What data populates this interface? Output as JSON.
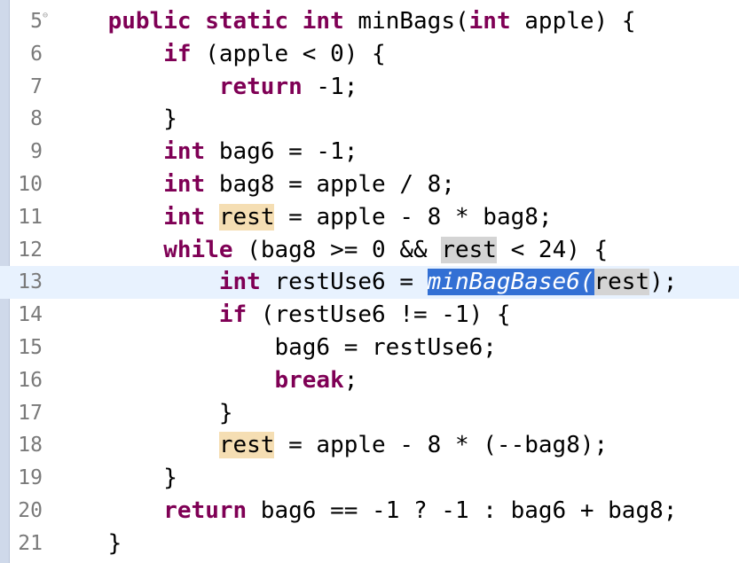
{
  "editor": {
    "lines": [
      {
        "num": "5",
        "tokens": [
          {
            "t": "    "
          },
          {
            "t": "public",
            "c": "kw"
          },
          {
            "t": " "
          },
          {
            "t": "static",
            "c": "kw"
          },
          {
            "t": " "
          },
          {
            "t": "int",
            "c": "kw"
          },
          {
            "t": " minBags("
          },
          {
            "t": "int",
            "c": "kw"
          },
          {
            "t": " apple) {"
          }
        ],
        "fold": true
      },
      {
        "num": "6",
        "tokens": [
          {
            "t": "        "
          },
          {
            "t": "if",
            "c": "kw"
          },
          {
            "t": " (apple < 0) {"
          }
        ]
      },
      {
        "num": "7",
        "tokens": [
          {
            "t": "            "
          },
          {
            "t": "return",
            "c": "kw"
          },
          {
            "t": " -1;"
          }
        ]
      },
      {
        "num": "8",
        "tokens": [
          {
            "t": "        }"
          }
        ]
      },
      {
        "num": "9",
        "tokens": [
          {
            "t": "        "
          },
          {
            "t": "int",
            "c": "kw"
          },
          {
            "t": " bag6 = -1;"
          }
        ]
      },
      {
        "num": "10",
        "tokens": [
          {
            "t": "        "
          },
          {
            "t": "int",
            "c": "kw"
          },
          {
            "t": " bag8 = apple / 8;"
          }
        ]
      },
      {
        "num": "11",
        "tokens": [
          {
            "t": "        "
          },
          {
            "t": "int",
            "c": "kw"
          },
          {
            "t": " "
          },
          {
            "t": "rest",
            "c": "occ"
          },
          {
            "t": " = apple - 8 * bag8;"
          }
        ]
      },
      {
        "num": "12",
        "tokens": [
          {
            "t": "        "
          },
          {
            "t": "while",
            "c": "kw"
          },
          {
            "t": " (bag8 >= 0 && "
          },
          {
            "t": "rest",
            "c": "occ-read"
          },
          {
            "t": " < 24) {"
          }
        ]
      },
      {
        "num": "13",
        "tokens": [
          {
            "t": "            "
          },
          {
            "t": "int",
            "c": "kw"
          },
          {
            "t": " restUse6 = "
          },
          {
            "t": "minBagBase6(",
            "c": "sel"
          },
          {
            "t": "rest",
            "c": "occ-read"
          },
          {
            "t": ");"
          }
        ],
        "current": true
      },
      {
        "num": "14",
        "tokens": [
          {
            "t": "            "
          },
          {
            "t": "if",
            "c": "kw"
          },
          {
            "t": " (restUse6 != -1) {"
          }
        ]
      },
      {
        "num": "15",
        "tokens": [
          {
            "t": "                bag6 = restUse6;"
          }
        ]
      },
      {
        "num": "16",
        "tokens": [
          {
            "t": "                "
          },
          {
            "t": "break",
            "c": "kw"
          },
          {
            "t": ";"
          }
        ]
      },
      {
        "num": "17",
        "tokens": [
          {
            "t": "            }"
          }
        ]
      },
      {
        "num": "18",
        "tokens": [
          {
            "t": "            "
          },
          {
            "t": "rest",
            "c": "occ"
          },
          {
            "t": " = apple - 8 * (--bag8);"
          }
        ]
      },
      {
        "num": "19",
        "tokens": [
          {
            "t": "        }"
          }
        ]
      },
      {
        "num": "20",
        "tokens": [
          {
            "t": "        "
          },
          {
            "t": "return",
            "c": "kw"
          },
          {
            "t": " bag6 == -1 ? -1 : bag6 + bag8;"
          }
        ]
      },
      {
        "num": "21",
        "tokens": [
          {
            "t": "    }"
          }
        ]
      }
    ]
  },
  "colors": {
    "keyword": "#7f0055",
    "selection": "#3370d4",
    "write_occurrence": "#f5deb3",
    "read_occurrence": "#d4d4d4",
    "current_line": "#e8f2fe"
  }
}
